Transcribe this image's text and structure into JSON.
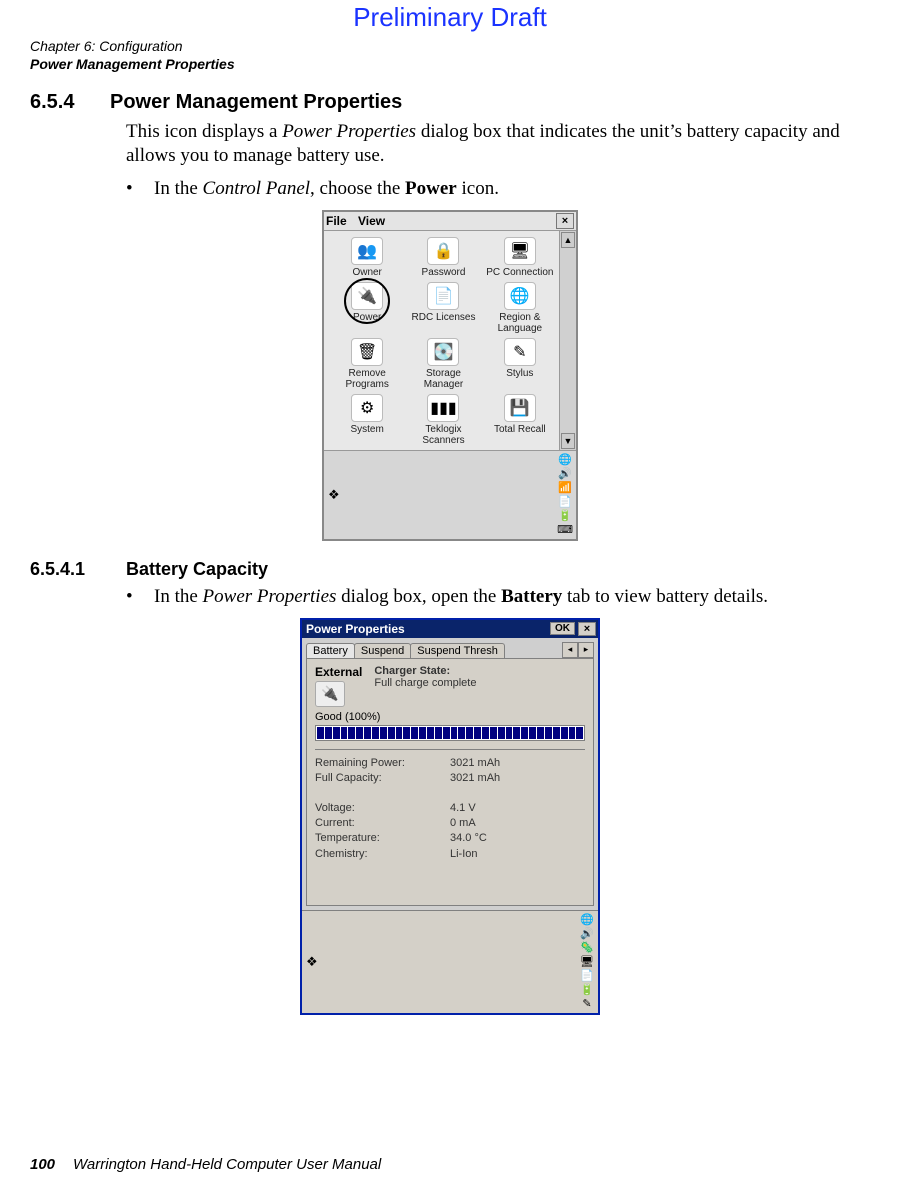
{
  "watermark": "Preliminary Draft",
  "running_head": {
    "chapter": "Chapter 6:  Configuration",
    "section": "Power Management Properties"
  },
  "section": {
    "number": "6.5.4",
    "title": "Power Management Properties",
    "para1_a": "This icon displays a ",
    "para1_ital": "Power Properties",
    "para1_b": " dialog box that indicates the unit’s battery capacity and allows you to manage battery use.",
    "bullet1_a": "In the ",
    "bullet1_ital": "Control Panel",
    "bullet1_b": ", choose the ",
    "bullet1_bold": "Power",
    "bullet1_c": " icon."
  },
  "subsection": {
    "number": "6.5.4.1",
    "title": "Battery Capacity",
    "bullet_a": "In the ",
    "bullet_ital": "Power Properties",
    "bullet_b": " dialog box, open the ",
    "bullet_bold": "Battery",
    "bullet_c": " tab to view battery details."
  },
  "control_panel": {
    "menu_file": "File",
    "menu_view": "View",
    "close_x": "×",
    "scroll_up": "▲",
    "scroll_down": "▼",
    "items": [
      {
        "label": "Owner",
        "glyph": "👥"
      },
      {
        "label": "Password",
        "glyph": "🔒"
      },
      {
        "label": "PC Connection",
        "glyph": "🖥"
      },
      {
        "label": "Power",
        "glyph": "🔌"
      },
      {
        "label": "RDC Licenses",
        "glyph": "📄"
      },
      {
        "label": "Region & Language",
        "glyph": "🌐"
      },
      {
        "label": "Remove Programs",
        "glyph": "🗑"
      },
      {
        "label": "Storage Manager",
        "glyph": "💽"
      },
      {
        "label": "Stylus",
        "glyph": "✎"
      },
      {
        "label": "System",
        "glyph": "⚙"
      },
      {
        "label": "Teklogix Scanners",
        "glyph": "▮▮▮"
      },
      {
        "label": "Total Recall",
        "glyph": "💾"
      }
    ],
    "tray": [
      "🌐",
      "🔊",
      "📶",
      "📄",
      "🔋",
      "⌨"
    ]
  },
  "power_props": {
    "title": "Power Properties",
    "ok": "OK",
    "close_x": "×",
    "tabs": {
      "t1": "Battery",
      "t2": "Suspend",
      "t3": "Suspend Thresh",
      "left": "◂",
      "right": "▸"
    },
    "external_label": "External",
    "charger_label": "Charger State:",
    "charger_value": "Full charge complete",
    "good_label": "Good  (100%)",
    "segments": 34,
    "rows": {
      "remaining_k": "Remaining Power:",
      "remaining_v": "3021 mAh",
      "full_k": "Full Capacity:",
      "full_v": "3021 mAh",
      "voltage_k": "Voltage:",
      "voltage_v": "4.1 V",
      "current_k": "Current:",
      "current_v": "0 mA",
      "temp_k": "Temperature:",
      "temp_v": "34.0 °C",
      "chem_k": "Chemistry:",
      "chem_v": "Li-Ion"
    },
    "tray": [
      "🌐",
      "🔊",
      "🦠",
      "🖥",
      "📄",
      "🔋",
      "✎"
    ]
  },
  "footer": {
    "page_number": "100",
    "booktitle": "Warrington Hand-Held Computer User Manual"
  }
}
